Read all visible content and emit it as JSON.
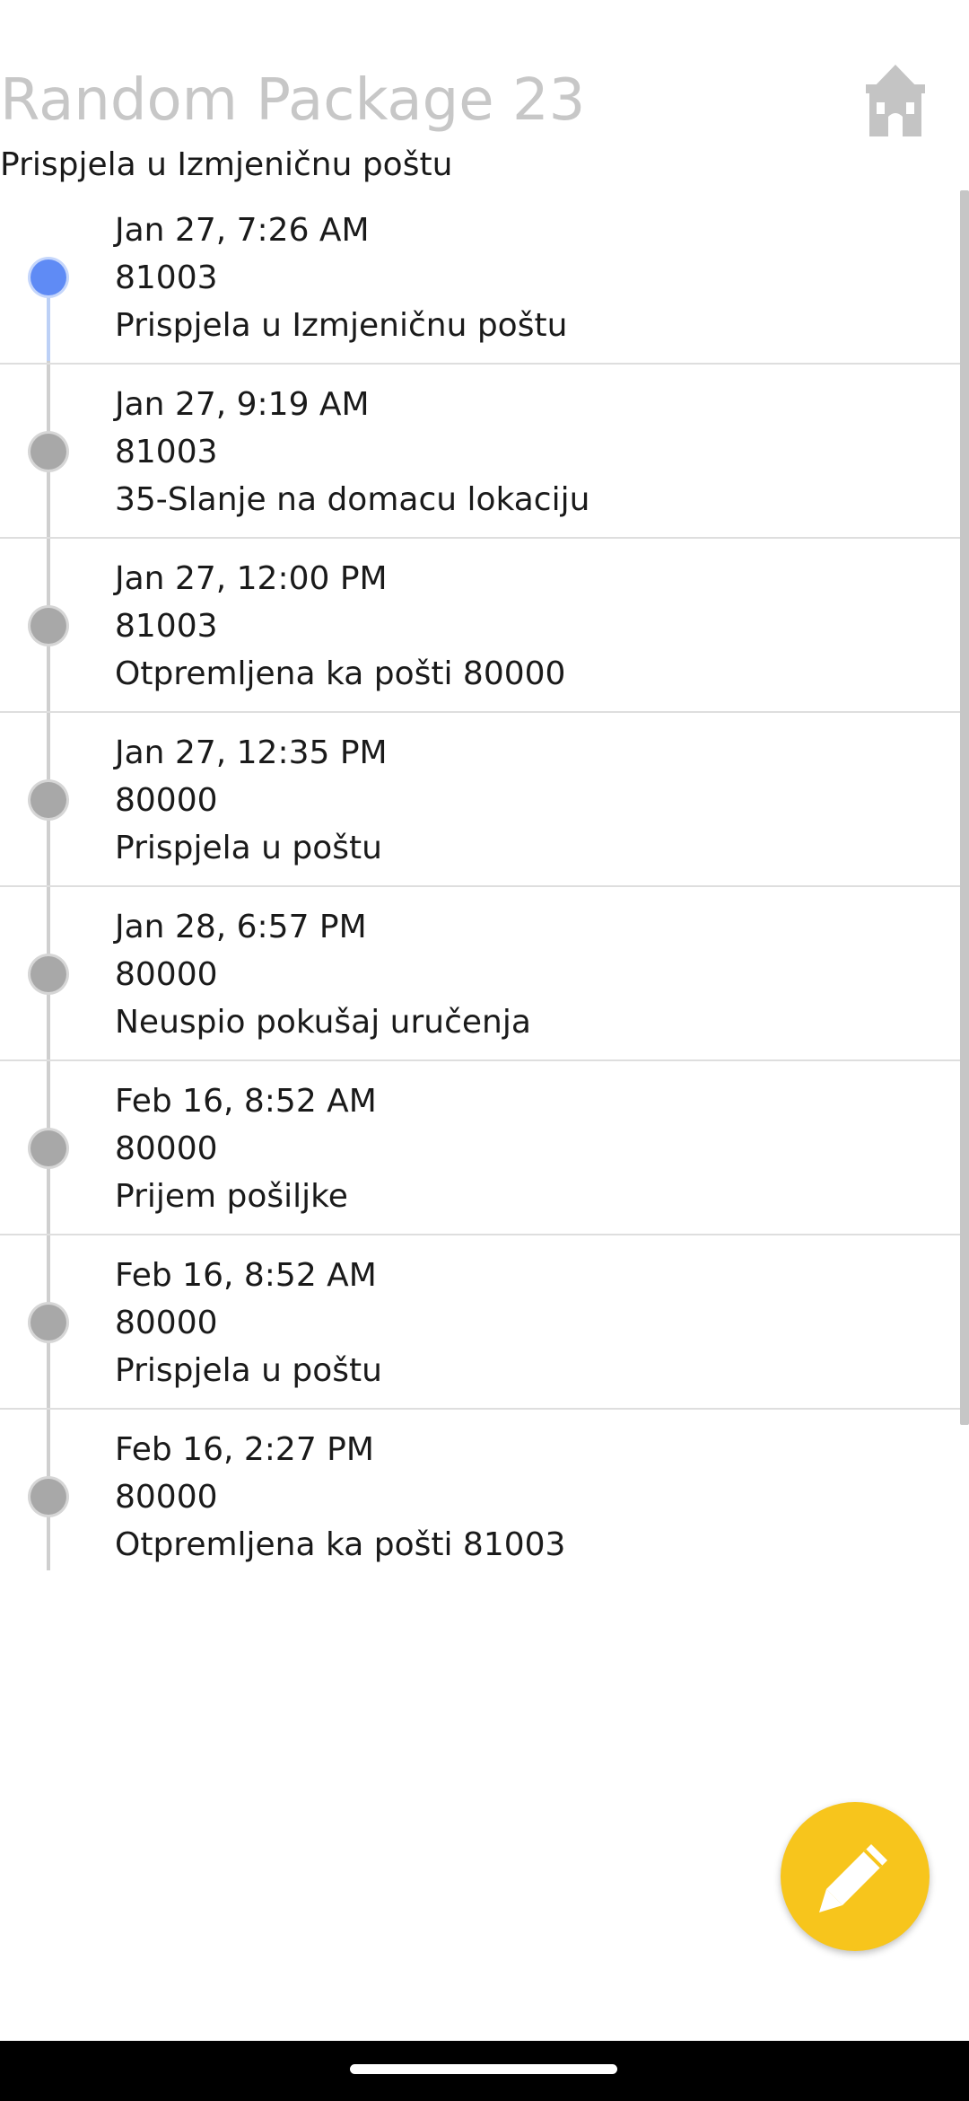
{
  "header": {
    "title": "Random Package 23",
    "subtitle": "Prispjela u Izmjeničnu poštu",
    "home_icon": "post-office-icon"
  },
  "colors": {
    "title_gray": "#c7c7c7",
    "active_dot": "#5f8bf5",
    "inactive_dot": "#a8a8a8",
    "fab_yellow": "#f7c51c"
  },
  "events": [
    {
      "datetime": "Jan 27, 7:26 AM",
      "code": "81003",
      "status": "Prispjela u Izmjeničnu poštu",
      "active": true
    },
    {
      "datetime": "Jan 27, 9:19 AM",
      "code": "81003",
      "status": "35-Slanje na domacu lokaciju",
      "active": false
    },
    {
      "datetime": "Jan 27, 12:00 PM",
      "code": "81003",
      "status": "Otpremljena ka pošti 80000",
      "active": false
    },
    {
      "datetime": "Jan 27, 12:35 PM",
      "code": "80000",
      "status": "Prispjela u poštu",
      "active": false
    },
    {
      "datetime": "Jan 28, 6:57 PM",
      "code": "80000",
      "status": "Neuspio pokušaj uručenja",
      "active": false
    },
    {
      "datetime": "Feb 16, 8:52 AM",
      "code": "80000",
      "status": "Prijem pošiljke",
      "active": false
    },
    {
      "datetime": "Feb 16, 8:52 AM",
      "code": "80000",
      "status": "Prispjela u poštu",
      "active": false
    },
    {
      "datetime": "Feb 16, 2:27 PM",
      "code": "80000",
      "status": "Otpremljena ka pošti 81003",
      "active": false
    }
  ],
  "fab": {
    "icon": "pencil-icon"
  }
}
